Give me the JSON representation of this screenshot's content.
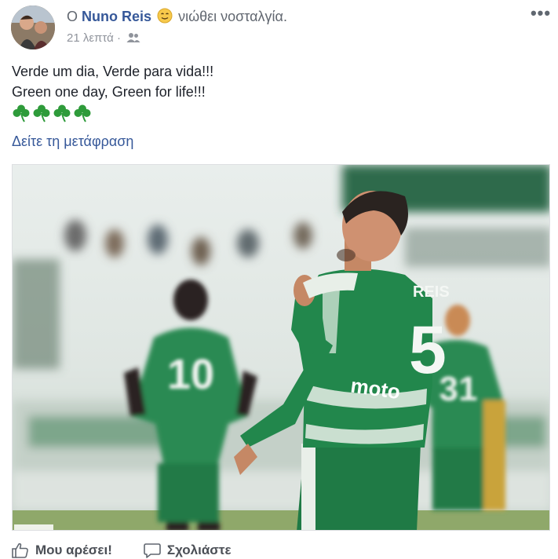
{
  "header": {
    "prefix": "Ο",
    "author_name": "Nuno Reis",
    "feeling": "νιώθει νοσταλγία.",
    "timestamp": "21 λεπτά",
    "separator": "·",
    "audience_icon": "friends-icon",
    "feeling_icon": "smiley-nostalgic-icon",
    "more_icon": "more-options-icon"
  },
  "post": {
    "lines": [
      "Verde um dia, Verde para vida!!!",
      "Green one day, Green for life!!!"
    ],
    "emoji_icon": "shamrock-icon",
    "emoji_count": 4,
    "translate_label": "Δείτε τη μετάφραση"
  },
  "photo": {
    "jersey_name": "REIS",
    "jersey_number": "5",
    "sponsor": "moto",
    "teammate_left_number": "10",
    "teammate_right_number": "31"
  },
  "actions": {
    "like_label": "Μου αρέσει!",
    "comment_label": "Σχολιάστε",
    "like_icon": "thumbs-up-icon",
    "comment_icon": "comment-icon"
  },
  "colors": {
    "link": "#365899",
    "text": "#1d2129",
    "meta": "#90949c",
    "kit_green": "#1f7a45",
    "shamrock": "#2e9b3a"
  }
}
